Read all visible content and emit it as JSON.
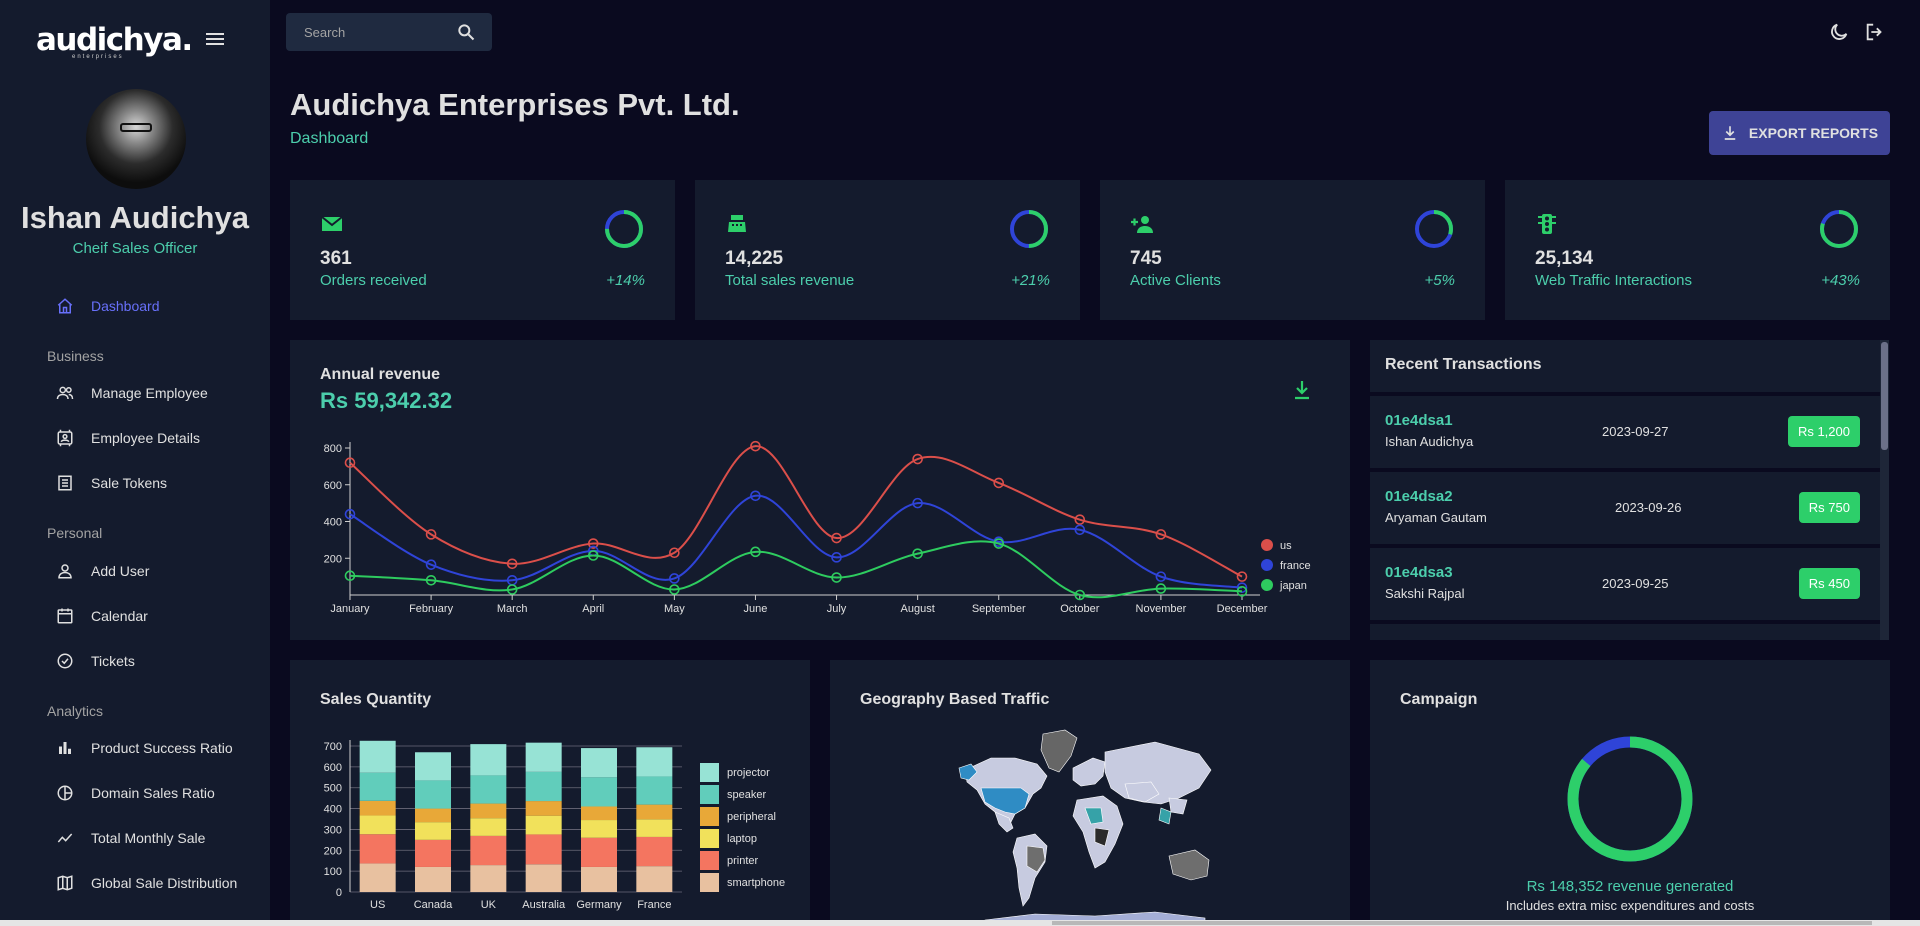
{
  "sidebar": {
    "brand": "audichya.",
    "brand_sub": "enterprises",
    "user_name": "Ishan Audichya",
    "user_role": "Cheif Sales Officer",
    "items": [
      {
        "label": "Dashboard",
        "icon": "home-icon",
        "active": true
      },
      {
        "section": "Business"
      },
      {
        "label": "Manage Employee",
        "icon": "people-icon"
      },
      {
        "label": "Employee Details",
        "icon": "contacts-icon"
      },
      {
        "label": "Sale Tokens",
        "icon": "receipt-icon"
      },
      {
        "section": "Personal"
      },
      {
        "label": "Add User",
        "icon": "person-icon"
      },
      {
        "label": "Calendar",
        "icon": "calendar-icon"
      },
      {
        "label": "Tickets",
        "icon": "help-icon"
      },
      {
        "section": "Analytics"
      },
      {
        "label": "Product Success Ratio",
        "icon": "bar-chart-icon"
      },
      {
        "label": "Domain Sales Ratio",
        "icon": "pie-chart-icon"
      },
      {
        "label": "Total Monthly Sale",
        "icon": "timeline-icon"
      },
      {
        "label": "Global Sale Distribution",
        "icon": "map-icon"
      }
    ]
  },
  "topbar": {
    "search_placeholder": "Search",
    "icons": [
      "search-icon",
      "dark-mode-icon",
      "logout-icon"
    ]
  },
  "header": {
    "title": "Audichya Enterprises Pvt. Ltd.",
    "subtitle": "Dashboard",
    "export_label": "EXPORT REPORTS"
  },
  "stats": [
    {
      "value": "361",
      "label": "Orders received",
      "increase": "+14%",
      "progress": 0.75,
      "icon": "email-icon"
    },
    {
      "value": "14,225",
      "label": "Total sales revenue",
      "increase": "+21%",
      "progress": 0.5,
      "icon": "cash-register-icon"
    },
    {
      "value": "745",
      "label": "Active Clients",
      "increase": "+5%",
      "progress": 0.3,
      "icon": "person-add-icon"
    },
    {
      "value": "25,134",
      "label": "Web Traffic Interactions",
      "increase": "+43%",
      "progress": 0.8,
      "icon": "traffic-icon"
    }
  ],
  "revenue": {
    "title": "Annual revenue",
    "value": "Rs 59,342.32"
  },
  "transactions": {
    "title": "Recent Transactions",
    "items": [
      {
        "id": "01e4dsa1",
        "user": "Ishan Audichya",
        "date": "2023-09-27",
        "cost": "Rs 1,200"
      },
      {
        "id": "01e4dsa2",
        "user": "Aryaman Gautam",
        "date": "2023-09-26",
        "cost": "Rs 750"
      },
      {
        "id": "01e4dsa3",
        "user": "Sakshi Rajpal",
        "date": "2023-09-25",
        "cost": "Rs 450"
      }
    ]
  },
  "sales_title": "Sales Quantity",
  "geo_title": "Geography Based Traffic",
  "campaign": {
    "title": "Campaign",
    "revenue": "Rs 148,352 revenue generated",
    "note": "Includes extra misc expenditures and costs",
    "progress": 0.86
  },
  "colors": {
    "accent": "#4cceac",
    "primary_bg": "#0a0a1f",
    "card_bg": "#141b2d",
    "active_nav": "#6870fa",
    "button": "#3e4396"
  },
  "chart_data": [
    {
      "type": "line",
      "title": "",
      "x": [
        "January",
        "February",
        "March",
        "April",
        "May",
        "June",
        "July",
        "August",
        "September",
        "October",
        "November",
        "December"
      ],
      "ylim": [
        0,
        800
      ],
      "yticks": [
        200,
        400,
        600,
        800
      ],
      "legend": "right",
      "series": [
        {
          "name": "us",
          "color": "#db4f4a",
          "values": [
            720,
            330,
            170,
            280,
            230,
            810,
            310,
            740,
            610,
            410,
            330,
            100
          ]
        },
        {
          "name": "france",
          "color": "#2f44d8",
          "values": [
            440,
            165,
            80,
            240,
            90,
            540,
            205,
            500,
            290,
            355,
            100,
            40
          ]
        },
        {
          "name": "japan",
          "color": "#2ecc5f",
          "values": [
            105,
            80,
            30,
            215,
            30,
            235,
            95,
            225,
            280,
            0,
            35,
            20
          ]
        }
      ]
    },
    {
      "type": "bar",
      "stacked": true,
      "title": "",
      "categories": [
        "US",
        "Canada",
        "UK",
        "Australia",
        "Germany",
        "France"
      ],
      "ylim": [
        0,
        700
      ],
      "yticks": [
        0,
        100,
        200,
        300,
        400,
        500,
        600,
        700
      ],
      "legend": "right",
      "series": [
        {
          "name": "smartphone",
          "color": "#e8c1a0",
          "values": [
            137,
            120,
            129,
            133,
            120,
            124
          ]
        },
        {
          "name": "printer",
          "color": "#f47560",
          "values": [
            140,
            130,
            140,
            143,
            140,
            140
          ]
        },
        {
          "name": "laptop",
          "color": "#f1e15b",
          "values": [
            90,
            85,
            85,
            90,
            85,
            85
          ]
        },
        {
          "name": "peripheral",
          "color": "#e8a838",
          "values": [
            70,
            65,
            70,
            70,
            65,
            70
          ]
        },
        {
          "name": "speaker",
          "color": "#61cdbb",
          "values": [
            135,
            135,
            135,
            140,
            140,
            135
          ]
        },
        {
          "name": "projector",
          "color": "#97e3d5",
          "values": [
            153,
            135,
            150,
            140,
            140,
            140
          ]
        }
      ]
    }
  ]
}
